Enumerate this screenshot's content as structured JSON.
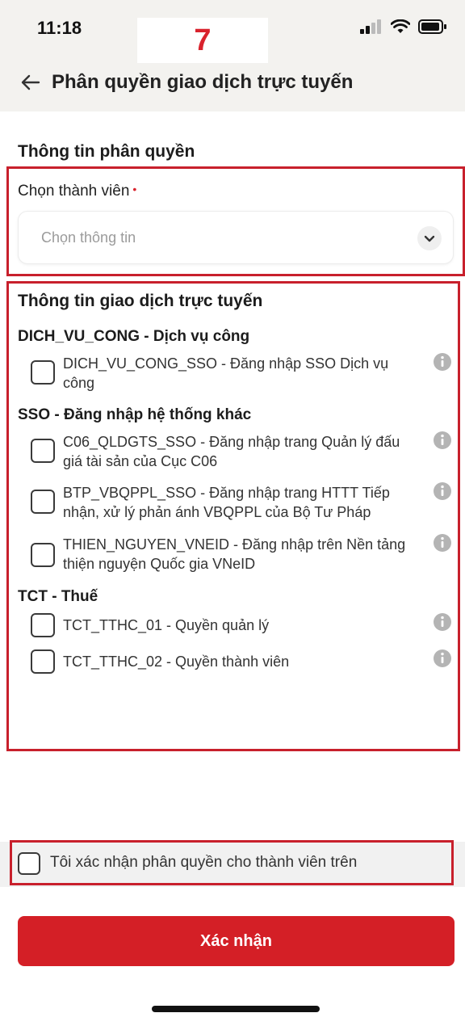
{
  "status_bar": {
    "time": "11:18"
  },
  "step_badge": "7",
  "header": {
    "title": "Phân quyền giao dịch trực tuyến"
  },
  "permission_info": {
    "title": "Thông tin phân quyền",
    "member_label": "Chọn thành viên",
    "required_mark": "•",
    "member_placeholder": "Chọn thông tin"
  },
  "online_info": {
    "title": "Thông tin giao dịch trực tuyến",
    "groups": [
      {
        "title": "DICH_VU_CONG - Dịch vụ công",
        "items": [
          {
            "label": "DICH_VU_CONG_SSO - Đăng nhập SSO Dịch vụ công",
            "checked": false
          }
        ]
      },
      {
        "title": "SSO - Đăng nhập hệ thống khác",
        "items": [
          {
            "label": "C06_QLDGTS_SSO - Đăng nhập trang Quản lý đấu giá tài sản của Cục C06",
            "checked": false
          },
          {
            "label": "BTP_VBQPPL_SSO - Đăng nhập trang HTTT Tiếp nhận, xử lý phản ánh VBQPPL của Bộ Tư Pháp",
            "checked": false
          },
          {
            "label": "THIEN_NGUYEN_VNEID - Đăng nhập trên Nền tảng thiện nguyện Quốc gia VNeID",
            "checked": false
          }
        ]
      },
      {
        "title": "TCT - Thuế",
        "items": [
          {
            "label": "TCT_TTHC_01 - Quyền quản lý",
            "checked": false
          },
          {
            "label": "TCT_TTHC_02 - Quyền thành viên",
            "checked": false
          }
        ]
      }
    ]
  },
  "confirm": {
    "label": "Tôi xác nhận phân quyền cho thành viên trên",
    "checked": false
  },
  "submit": {
    "label": "Xác nhận"
  },
  "colors": {
    "accent": "#d41f26",
    "highlight_frame": "#c8202c"
  },
  "icons": [
    "back-arrow-icon",
    "signal-icon",
    "wifi-icon",
    "battery-icon",
    "chevron-down-icon",
    "info-icon"
  ]
}
